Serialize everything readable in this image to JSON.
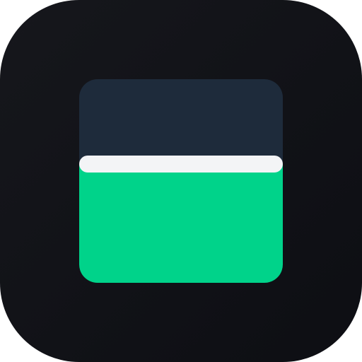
{
  "app_icon": {
    "icon_name": "fill-level-icon",
    "fill_level": 0.58,
    "colors": {
      "tile": "#15161b",
      "panel_top": "#1e2b3b",
      "fill": "#00d38a",
      "divider": "#f3f4f6"
    }
  }
}
